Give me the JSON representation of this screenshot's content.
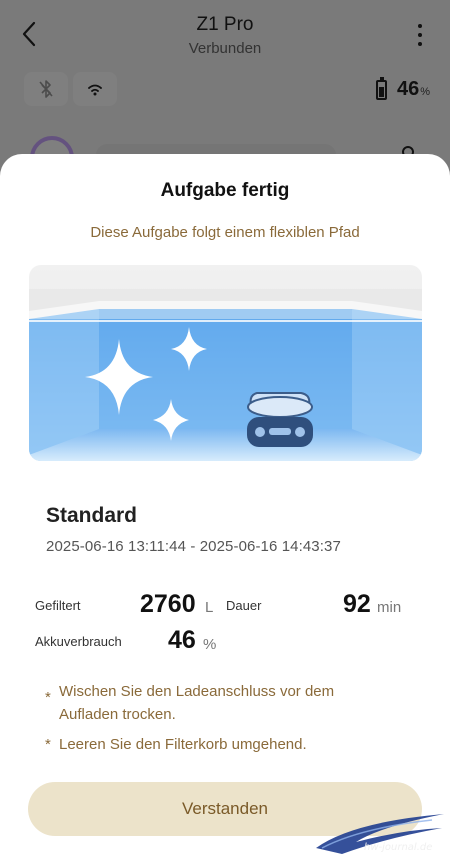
{
  "header": {
    "title": "Z1 Pro",
    "status": "Verbunden"
  },
  "device_status": {
    "battery_value": "46",
    "battery_unit": "%"
  },
  "dialog": {
    "title": "Aufgabe fertig",
    "subtitle": "Diese Aufgabe folgt einem flexiblen Pfad",
    "mode": "Standard",
    "time_range": "2025-06-16 13:11:44 - 2025-06-16 14:43:37",
    "stats": {
      "filtered_label": "Gefiltert",
      "filtered_value": "2760",
      "filtered_unit": "L",
      "duration_label": "Dauer",
      "duration_value": "92",
      "duration_unit": "min",
      "battery_label": "Akkuverbrauch",
      "battery_value": "46",
      "battery_unit": "%"
    },
    "notes": [
      {
        "bullet": "*",
        "line1": "Wischen Sie den Ladeanschluss vor dem",
        "line2": "Aufladen trocken."
      },
      {
        "bullet": "*",
        "line1": "Leeren Sie den Filterkorb umgehend."
      }
    ],
    "confirm_label": "Verstanden"
  },
  "watermark": {
    "text": "hw-journal.de"
  },
  "colors": {
    "accent_text": "#8a6a3a",
    "button_bg": "#ece3ca",
    "pool_water": "#5aa8f0"
  },
  "icons": [
    "back-arrow-icon",
    "more-vertical-icon",
    "bluetooth-off-icon",
    "wifi-icon",
    "battery-icon",
    "sparkle-icon",
    "pool-robot-icon",
    "location-pin-icon"
  ]
}
